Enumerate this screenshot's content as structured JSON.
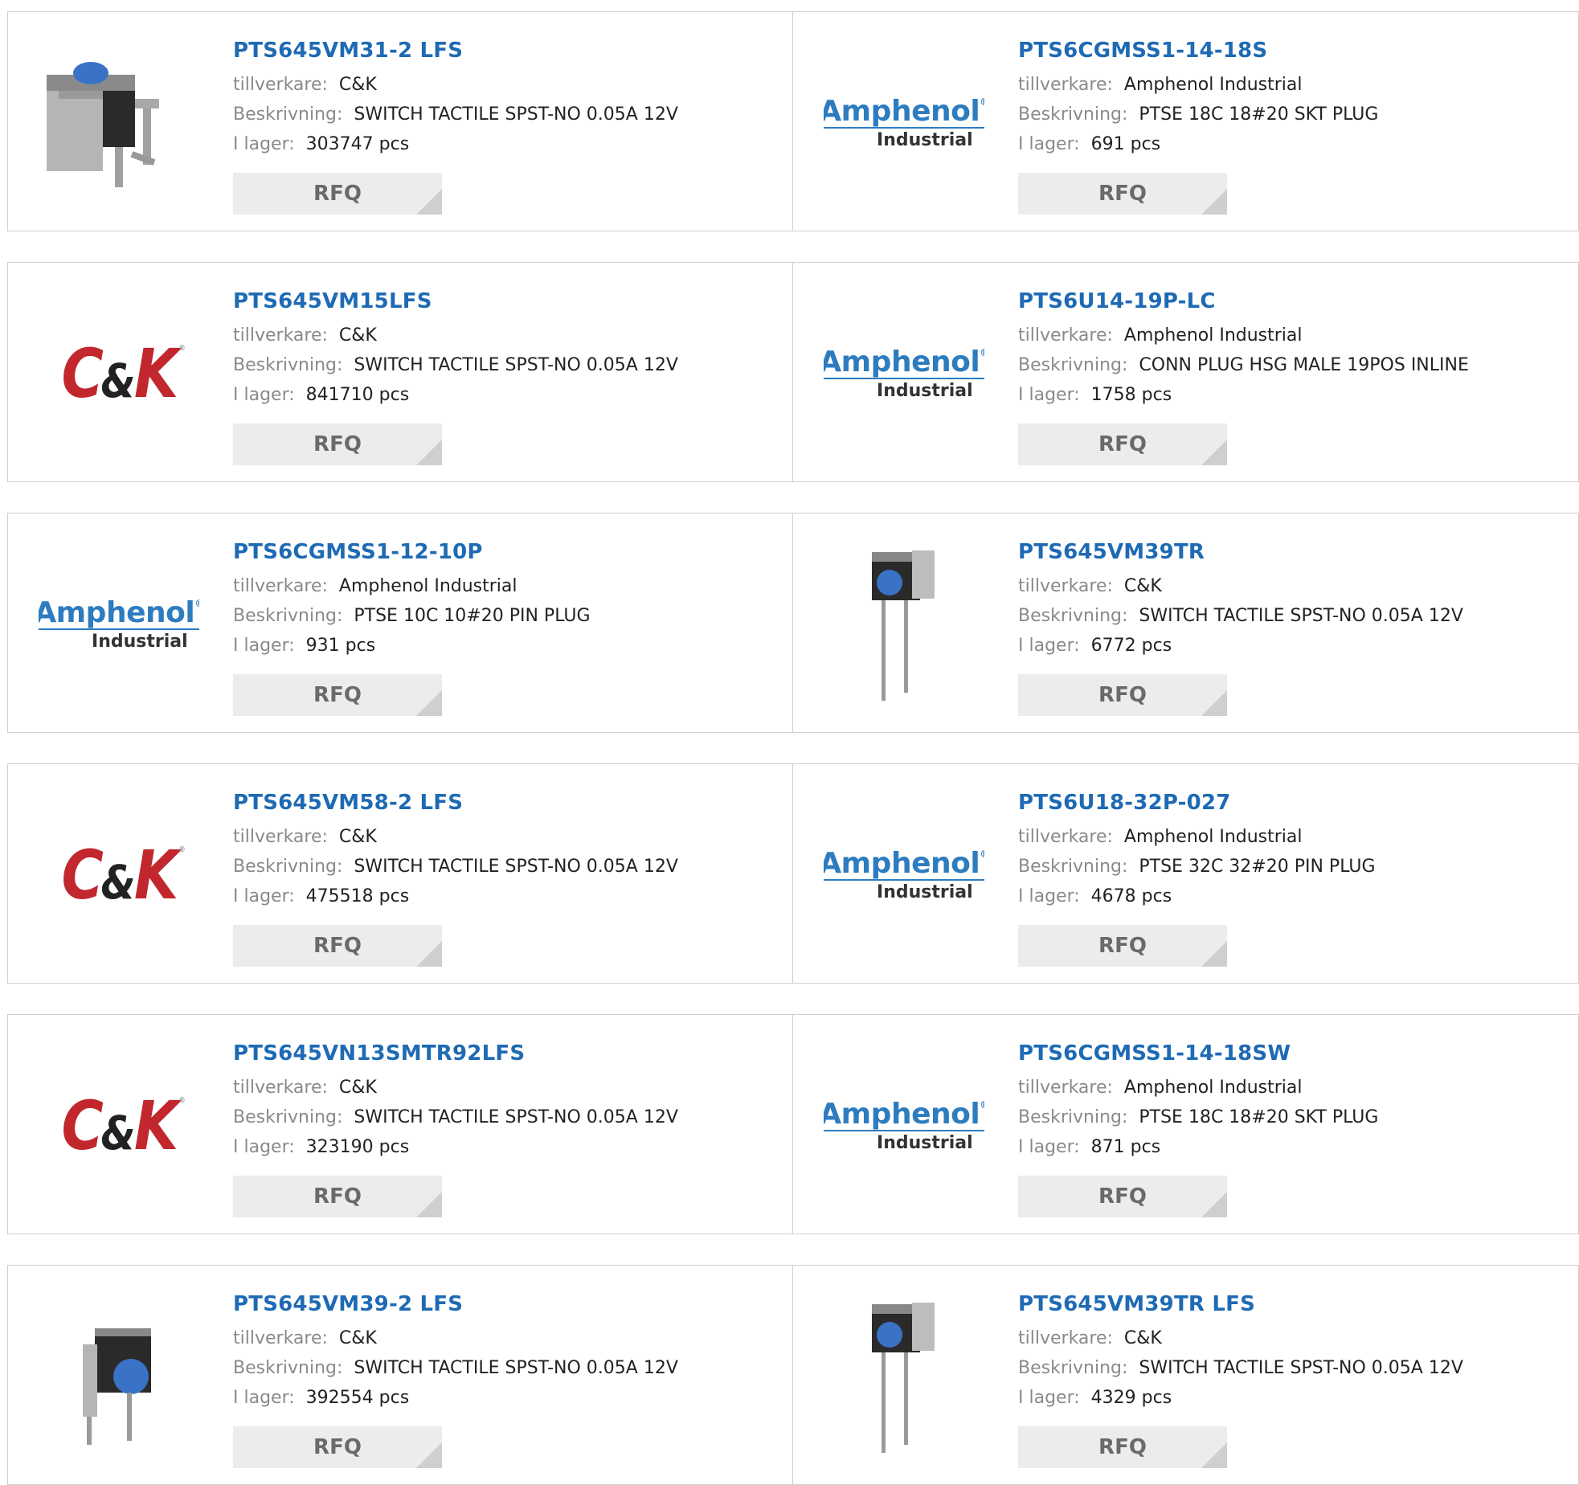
{
  "labels": {
    "manufacturer": "tillverkare:",
    "description": "Beskrivning:",
    "stock": "I lager:"
  },
  "rfq_label": "RFQ",
  "colors": {
    "link": "#1e6ab4",
    "ck_red": "#c1272d",
    "amphenol_blue": "#2d7cbf",
    "button_bg": "#ececec"
  },
  "products": [
    {
      "part": "PTS645VM31-2 LFS",
      "manufacturer": "C&K",
      "description": "SWITCH TACTILE SPST-NO 0.05A 12V",
      "stock": "303747 pcs",
      "image": "switch-right-angle"
    },
    {
      "part": "PTS6CGMSS1-14-18S",
      "manufacturer": "Amphenol Industrial",
      "description": "PTSE 18C 18#20 SKT PLUG",
      "stock": "691 pcs",
      "image": "amphenol-logo"
    },
    {
      "part": "PTS645VM15LFS",
      "manufacturer": "C&K",
      "description": "SWITCH TACTILE SPST-NO 0.05A 12V",
      "stock": "841710 pcs",
      "image": "ck-logo"
    },
    {
      "part": "PTS6U14-19P-LC",
      "manufacturer": "Amphenol Industrial",
      "description": "CONN PLUG HSG MALE 19POS INLINE",
      "stock": "1758 pcs",
      "image": "amphenol-logo"
    },
    {
      "part": "PTS6CGMSS1-12-10P",
      "manufacturer": "Amphenol Industrial",
      "description": "PTSE 10C 10#20 PIN PLUG",
      "stock": "931 pcs",
      "image": "amphenol-logo"
    },
    {
      "part": "PTS645VM39TR",
      "manufacturer": "C&K",
      "description": "SWITCH TACTILE SPST-NO 0.05A 12V",
      "stock": "6772 pcs",
      "image": "switch-vertical"
    },
    {
      "part": "PTS645VM58-2 LFS",
      "manufacturer": "C&K",
      "description": "SWITCH TACTILE SPST-NO 0.05A 12V",
      "stock": "475518 pcs",
      "image": "ck-logo"
    },
    {
      "part": "PTS6U18-32P-027",
      "manufacturer": "Amphenol Industrial",
      "description": "PTSE 32C 32#20 PIN PLUG",
      "stock": "4678 pcs",
      "image": "amphenol-logo"
    },
    {
      "part": "PTS645VN13SMTR92LFS",
      "manufacturer": "C&K",
      "description": "SWITCH TACTILE SPST-NO 0.05A 12V",
      "stock": "323190 pcs",
      "image": "ck-logo"
    },
    {
      "part": "PTS6CGMSS1-14-18SW",
      "manufacturer": "Amphenol Industrial",
      "description": "PTSE 18C 18#20 SKT PLUG",
      "stock": "871 pcs",
      "image": "amphenol-logo"
    },
    {
      "part": "PTS645VM39-2 LFS",
      "manufacturer": "C&K",
      "description": "SWITCH TACTILE SPST-NO 0.05A 12V",
      "stock": "392554 pcs",
      "image": "switch-side"
    },
    {
      "part": "PTS645VM39TR LFS",
      "manufacturer": "C&K",
      "description": "SWITCH TACTILE SPST-NO 0.05A 12V",
      "stock": "4329 pcs",
      "image": "switch-vertical"
    }
  ]
}
